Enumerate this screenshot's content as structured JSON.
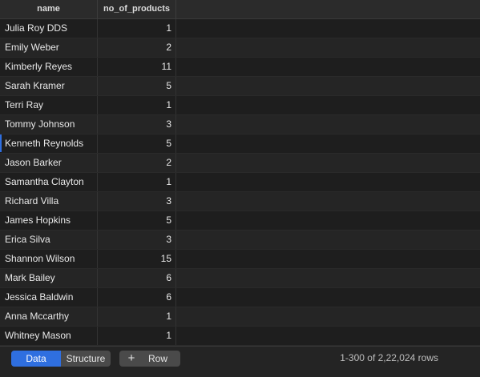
{
  "table": {
    "columns": [
      "name",
      "no_of_products"
    ],
    "rows": [
      [
        "Julia Roy DDS",
        "1"
      ],
      [
        "Emily Weber",
        "2"
      ],
      [
        "Kimberly Reyes",
        "11"
      ],
      [
        "Sarah Kramer",
        "5"
      ],
      [
        "Terri Ray",
        "1"
      ],
      [
        "Tommy Johnson",
        "3"
      ],
      [
        "Kenneth Reynolds",
        "5"
      ],
      [
        "Jason Barker",
        "2"
      ],
      [
        "Samantha Clayton",
        "1"
      ],
      [
        "Richard Villa",
        "3"
      ],
      [
        "James Hopkins",
        "5"
      ],
      [
        "Erica Silva",
        "3"
      ],
      [
        "Shannon Wilson",
        "15"
      ],
      [
        "Mark Bailey",
        "6"
      ],
      [
        "Jessica Baldwin",
        "6"
      ],
      [
        "Anna Mccarthy",
        "1"
      ],
      [
        "Whitney Mason",
        "1"
      ]
    ]
  },
  "footer": {
    "data_label": "Data",
    "structure_label": "Structure",
    "add_row_label": "Row",
    "status": "1-300 of 2,22,024 rows"
  }
}
